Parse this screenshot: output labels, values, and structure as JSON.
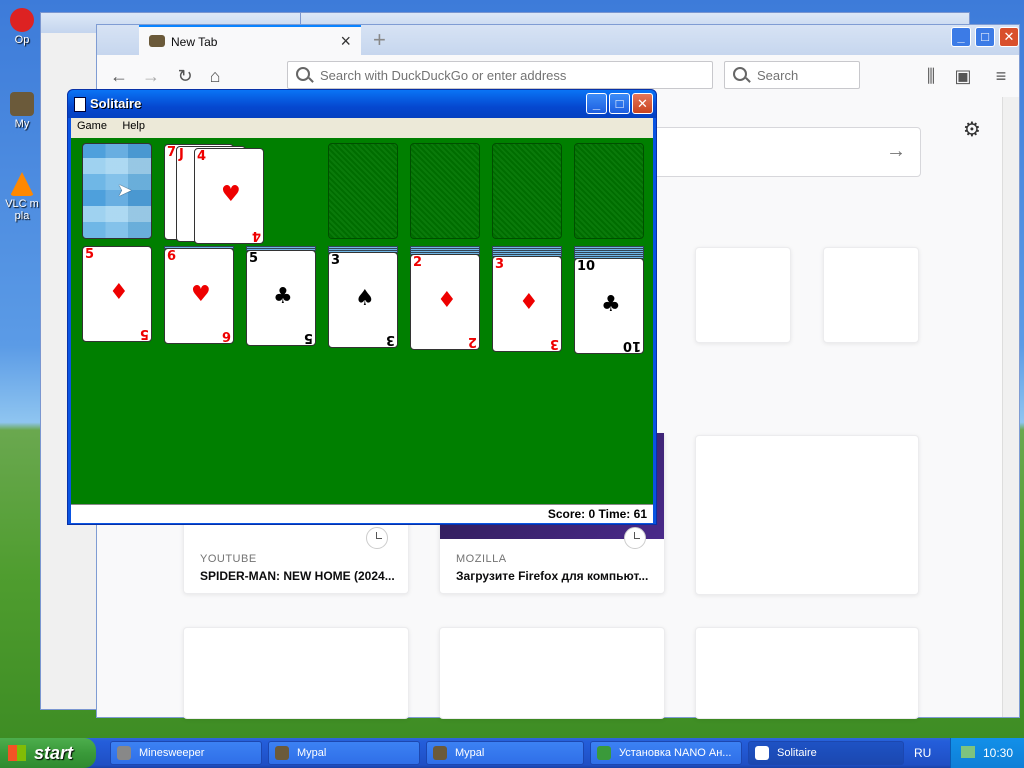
{
  "desktop": {
    "icons": [
      {
        "label": "Op"
      },
      {
        "label": "My"
      },
      {
        "label": "VLC m pla"
      }
    ]
  },
  "firefox": {
    "tab_title": "New Tab",
    "url_placeholder": "Search with DuckDuckGo or enter address",
    "search_placeholder": "Search",
    "highlights": [
      {
        "source": "YOUTUBE",
        "title": "SPIDER-MAN: NEW HOME (2024..."
      },
      {
        "source": "MOZILLA",
        "title": "Загрузите Firefox для компьют..."
      }
    ]
  },
  "solitaire": {
    "title": "Solitaire",
    "menu": [
      "Game",
      "Help"
    ],
    "status": "Score: 0 Time: 61",
    "waste": [
      {
        "rank": "7",
        "suit": "♥",
        "color": "red"
      },
      {
        "rank": "J",
        "suit": "♥",
        "color": "red"
      },
      {
        "rank": "4",
        "suit": "♥",
        "color": "red"
      }
    ],
    "tableau": [
      {
        "rank": "5",
        "suit": "♦",
        "color": "red"
      },
      {
        "rank": "6",
        "suit": "♥",
        "color": "red"
      },
      {
        "rank": "5",
        "suit": "♣",
        "color": "black"
      },
      {
        "rank": "3",
        "suit": "♠",
        "color": "black"
      },
      {
        "rank": "2",
        "suit": "♦",
        "color": "red"
      },
      {
        "rank": "3",
        "suit": "♦",
        "color": "red"
      },
      {
        "rank": "10",
        "suit": "♣",
        "color": "black"
      }
    ]
  },
  "taskbar": {
    "start_label": "start",
    "tasks": [
      "Minesweeper",
      "Mypal",
      "Mypal",
      "Установка NANO Ан...",
      "Solitaire"
    ],
    "language": "RU",
    "clock": "10:30"
  }
}
